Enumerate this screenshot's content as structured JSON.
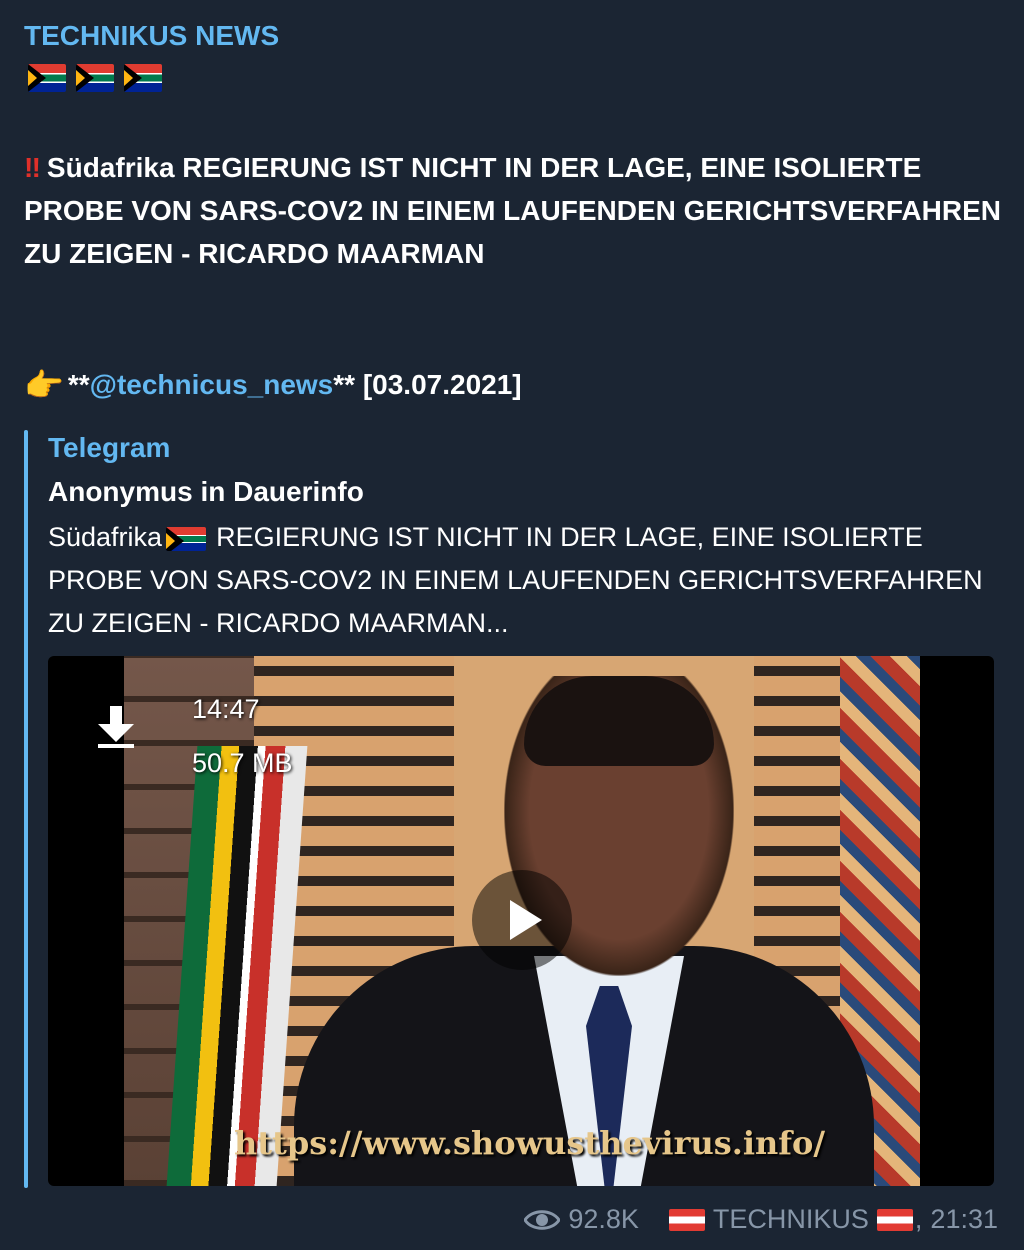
{
  "post": {
    "channel": "TECHNIKUS NEWS",
    "headline": "Südafrika REGIERUNG IST NICHT IN DER LAGE, EINE ISOLIERTE PROBE VON SARS-COV2 IN EINEM LAUFENDEN GERICHTSVERFAHREN ZU ZEIGEN - RICARDO MAARMAN",
    "credit_prefix": "**",
    "credit_handle": "@technicus_news",
    "credit_suffix": "** [03.07.2021]"
  },
  "preview": {
    "site": "Telegram",
    "title": "Anonymus in Dauerinfo",
    "desc_start": "Südafrika",
    "desc_rest": "REGIERUNG IST NICHT IN DER LAGE, EINE ISOLIERTE PROBE VON SARS-COV2 IN EINEM LAUFENDEN GERICHTSVERFAHREN ZU ZEIGEN - RICARDO MAARMAN..."
  },
  "video": {
    "duration": "14:47",
    "size": "50.7 MB",
    "caption_url": "https://www.showusthevirus.info/"
  },
  "footer": {
    "views": "92.8K",
    "author": "TECHNIKUS",
    "author_suffix": ",",
    "time": "21:31"
  },
  "icons": {
    "flag": "south-africa-flag-icon",
    "double_exclamation": "‼",
    "pointing": "👉",
    "eye": "eye-icon",
    "download": "download-icon",
    "play": "play-icon"
  },
  "colors": {
    "background": "#1b2533",
    "link": "#63b8f1",
    "meta": "#8796a8"
  }
}
